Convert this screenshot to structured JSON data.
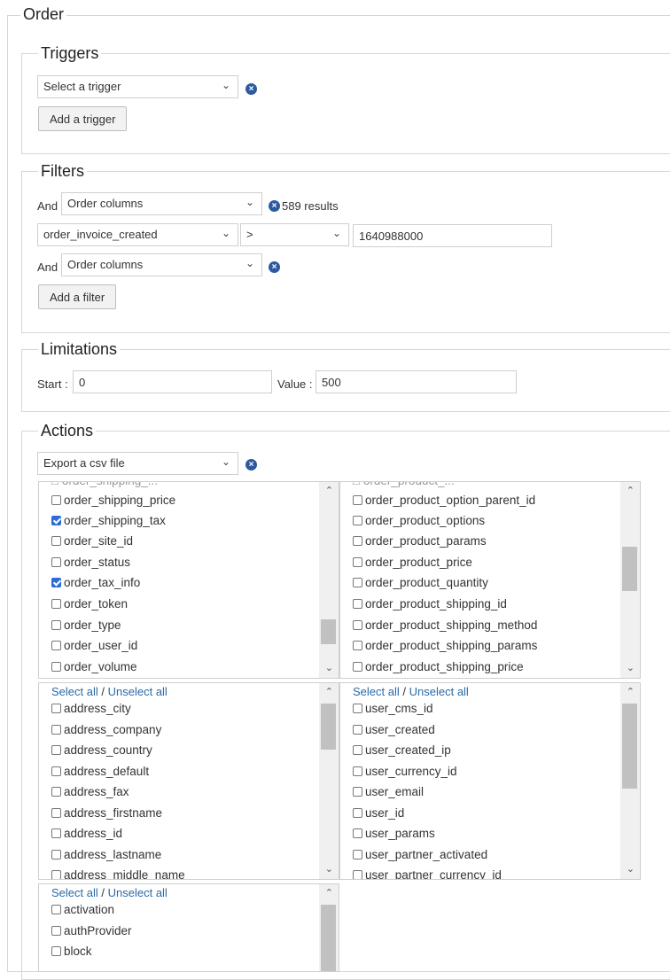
{
  "order": {
    "title": "Order"
  },
  "triggers": {
    "legend": "Triggers",
    "select_value": "Select a trigger",
    "add_button": "Add a trigger"
  },
  "filters": {
    "legend": "Filters",
    "row1": {
      "and_label": "And",
      "select_value": "Order columns",
      "results": "589 results"
    },
    "row2": {
      "column_value": "order_invoice_created",
      "operator_value": ">",
      "value": "1640988000"
    },
    "row3": {
      "and_label": "And",
      "select_value": "Order columns"
    },
    "add_button": "Add a filter"
  },
  "limitations": {
    "legend": "Limitations",
    "start_label": "Start :",
    "start_value": "0",
    "value_label": "Value :",
    "value_value": "500"
  },
  "actions": {
    "legend": "Actions",
    "select_value": "Export a csv file",
    "order_columns": [
      {
        "label": "order_shipping_price",
        "checked": false
      },
      {
        "label": "order_shipping_tax",
        "checked": true
      },
      {
        "label": "order_site_id",
        "checked": false
      },
      {
        "label": "order_status",
        "checked": false
      },
      {
        "label": "order_tax_info",
        "checked": true
      },
      {
        "label": "order_token",
        "checked": false
      },
      {
        "label": "order_type",
        "checked": false
      },
      {
        "label": "order_user_id",
        "checked": false
      },
      {
        "label": "order_volume",
        "checked": false
      }
    ],
    "product_columns": [
      {
        "label": "order_product_option_parent_id",
        "checked": false
      },
      {
        "label": "order_product_options",
        "checked": false
      },
      {
        "label": "order_product_params",
        "checked": false
      },
      {
        "label": "order_product_price",
        "checked": false
      },
      {
        "label": "order_product_quantity",
        "checked": false
      },
      {
        "label": "order_product_shipping_id",
        "checked": false
      },
      {
        "label": "order_product_shipping_method",
        "checked": false
      },
      {
        "label": "order_product_shipping_params",
        "checked": false
      },
      {
        "label": "order_product_shipping_price",
        "checked": false
      }
    ],
    "select_all": "Select all",
    "separator": "/",
    "unselect_all": "Unselect all",
    "address_columns": [
      {
        "label": "address_city"
      },
      {
        "label": "address_company"
      },
      {
        "label": "address_country"
      },
      {
        "label": "address_default"
      },
      {
        "label": "address_fax"
      },
      {
        "label": "address_firstname"
      },
      {
        "label": "address_id"
      },
      {
        "label": "address_lastname"
      },
      {
        "label": "address_middle_name"
      }
    ],
    "user_columns": [
      {
        "label": "user_cms_id"
      },
      {
        "label": "user_created"
      },
      {
        "label": "user_created_ip"
      },
      {
        "label": "user_currency_id"
      },
      {
        "label": "user_email"
      },
      {
        "label": "user_id"
      },
      {
        "label": "user_params"
      },
      {
        "label": "user_partner_activated"
      },
      {
        "label": "user_partner_currency_id"
      }
    ],
    "joomla_columns": [
      {
        "label": "activation"
      },
      {
        "label": "authProvider"
      },
      {
        "label": "block"
      }
    ]
  },
  "icons": {
    "remove": "remove-circle-icon",
    "dropdown": "chevron-down-icon",
    "scroll_up": "chevron-up-icon",
    "scroll_down": "chevron-down-icon",
    "check": "check-icon"
  },
  "colors": {
    "accent": "#2a6cd8",
    "link": "#2a6aa8",
    "remove_icon": "#2c5aa0"
  }
}
